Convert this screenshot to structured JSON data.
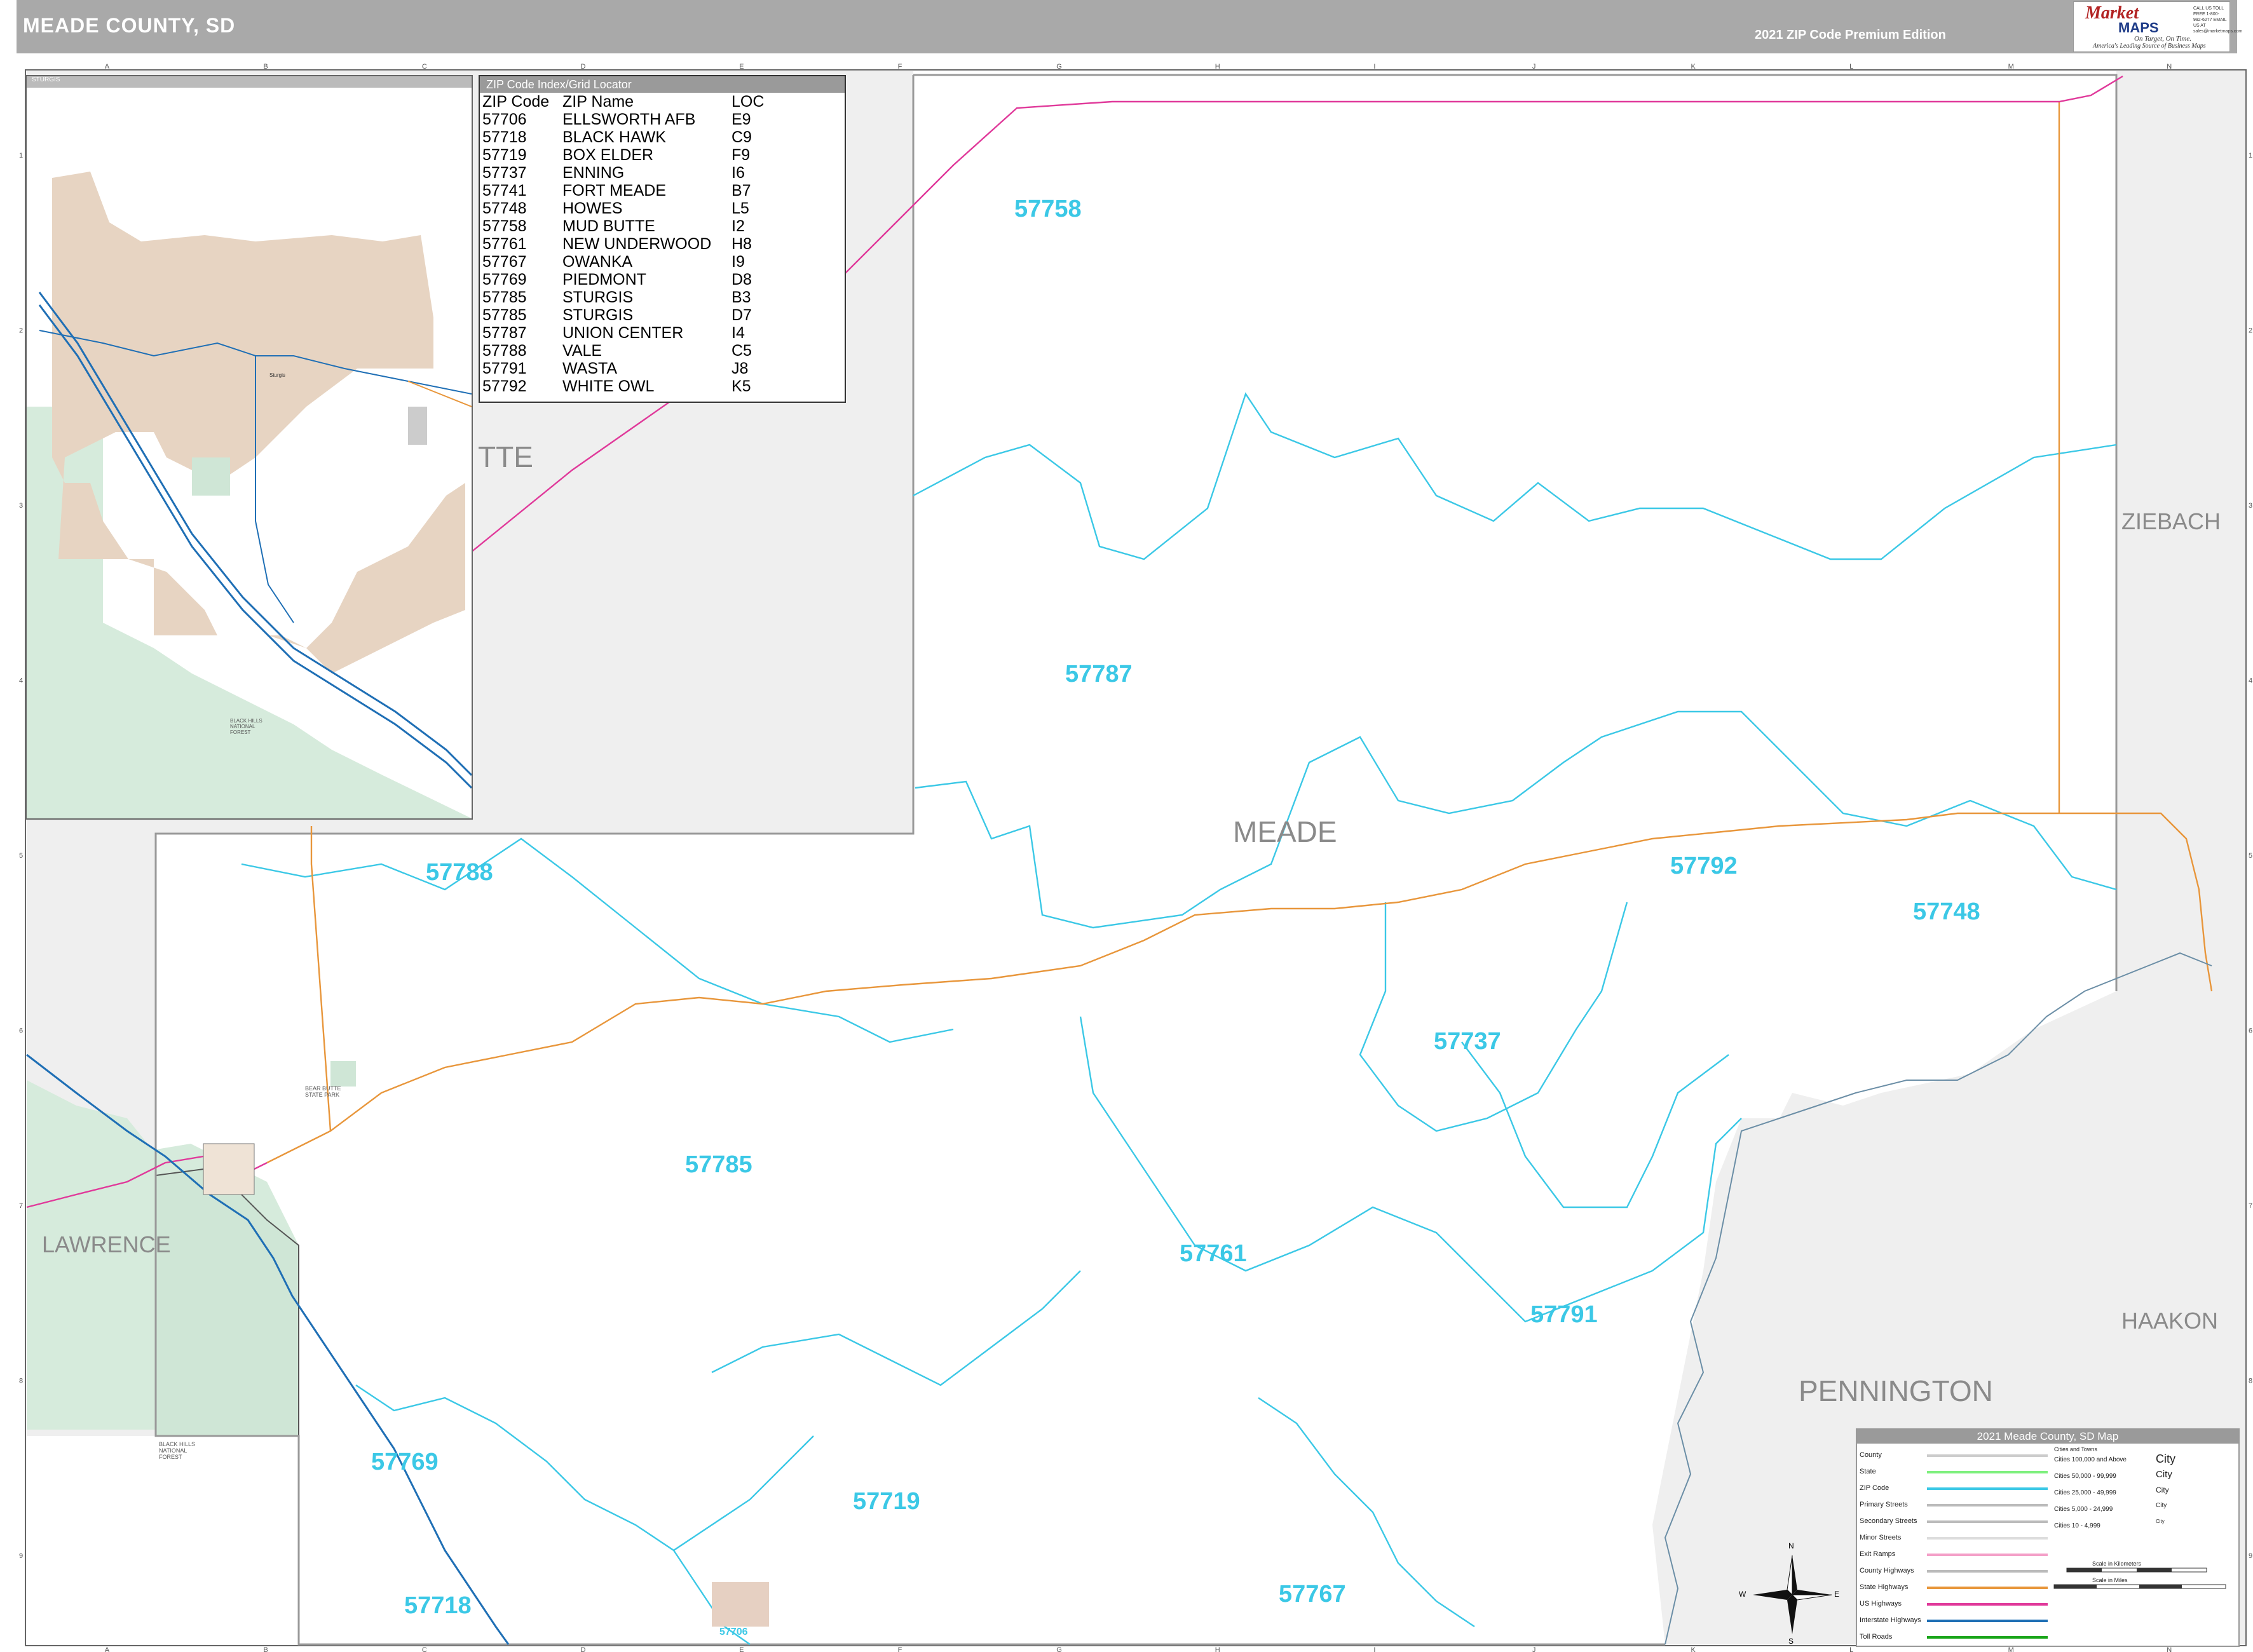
{
  "header": {
    "title": "MEADE COUNTY, SD",
    "edition": "2021 ZIP Code Premium Edition"
  },
  "logo": {
    "brand": "Market",
    "brand2": "MAPS",
    "tagline1": "On Target, On Time.",
    "tagline2": "America's Leading Source of Business Maps",
    "contact": "CALL US TOLL FREE 1-800-992-6277 EMAIL US AT sales@marketmaps.com"
  },
  "grid": {
    "columns": [
      "A",
      "B",
      "C",
      "D",
      "E",
      "F",
      "G",
      "H",
      "I",
      "J",
      "K",
      "L",
      "M",
      "N"
    ],
    "rows": [
      "1",
      "2",
      "3",
      "4",
      "5",
      "6",
      "7",
      "8",
      "9"
    ]
  },
  "zip_index": {
    "header": "ZIP Code Index/Grid Locator",
    "columns": [
      "ZIP Code",
      "ZIP Name",
      "LOC"
    ],
    "rows": [
      [
        "57706",
        "ELLSWORTH AFB",
        "E9"
      ],
      [
        "57718",
        "BLACK HAWK",
        "C9"
      ],
      [
        "57719",
        "BOX ELDER",
        "F9"
      ],
      [
        "57737",
        "ENNING",
        "I6"
      ],
      [
        "57741",
        "FORT MEADE",
        "B7"
      ],
      [
        "57748",
        "HOWES",
        "L5"
      ],
      [
        "57758",
        "MUD BUTTE",
        "I2"
      ],
      [
        "57761",
        "NEW UNDERWOOD",
        "H8"
      ],
      [
        "57767",
        "OWANKA",
        "I9"
      ],
      [
        "57769",
        "PIEDMONT",
        "D8"
      ],
      [
        "57785",
        "STURGIS",
        "B3"
      ],
      [
        "57785",
        "STURGIS",
        "D7"
      ],
      [
        "57787",
        "UNION CENTER",
        "I4"
      ],
      [
        "57788",
        "VALE",
        "C5"
      ],
      [
        "57791",
        "WASTA",
        "J8"
      ],
      [
        "57792",
        "WHITE OWL",
        "K5"
      ]
    ]
  },
  "inset": {
    "header": "STURGIS",
    "labels": [
      "BLACK HILLS NATIONAL FOREST",
      "Sturgis"
    ]
  },
  "zip_labels": [
    "57758",
    "57787",
    "57788",
    "57792",
    "57748",
    "57737",
    "57785",
    "57761",
    "57791",
    "57769",
    "57719",
    "57767",
    "57718",
    "57706"
  ],
  "county_labels": {
    "meade": "MEADE",
    "ziebach": "ZIEBACH",
    "lawrence": "LAWRENCE",
    "haakon": "HAAKON",
    "pennington": "PENNINGTON",
    "butte_partial": "TTE"
  },
  "forest_labels": {
    "main": "BLACK HILLS NATIONAL FOREST",
    "bear_butte": "BEAR BUTTE STATE PARK"
  },
  "legend": {
    "title": "2021 Meade County, SD Map",
    "line_items": [
      "County",
      "State",
      "ZIP Code",
      "Primary Streets",
      "Secondary Streets",
      "Minor Streets",
      "Exit Ramps",
      "County Highways",
      "State Highways",
      "US Highways",
      "Interstate Highways",
      "Toll Roads"
    ],
    "cities_header": "Cities and Towns",
    "city_items": [
      {
        "range": "Cities 100,000 and Above",
        "sample": "City"
      },
      {
        "range": "Cities 50,000 - 99,999",
        "sample": "City"
      },
      {
        "range": "Cities 25,000 - 49,999",
        "sample": "City"
      },
      {
        "range": "Cities 5,000 - 24,999",
        "sample": "City"
      },
      {
        "range": "Cities 10 - 4,999",
        "sample": "City"
      }
    ],
    "scale_km": "Scale in Kilometers",
    "scale_mi": "Scale in Miles",
    "colors": {
      "county": "#cccccc",
      "state": "#7ef07e",
      "zip": "#3bc8e6",
      "state_hwy": "#e8963b",
      "us_hwy": "#e0399a",
      "interstate": "#1f6fb5",
      "toll": "#19a519"
    }
  },
  "compass": {
    "n": "N",
    "s": "S",
    "e": "E",
    "w": "W"
  }
}
